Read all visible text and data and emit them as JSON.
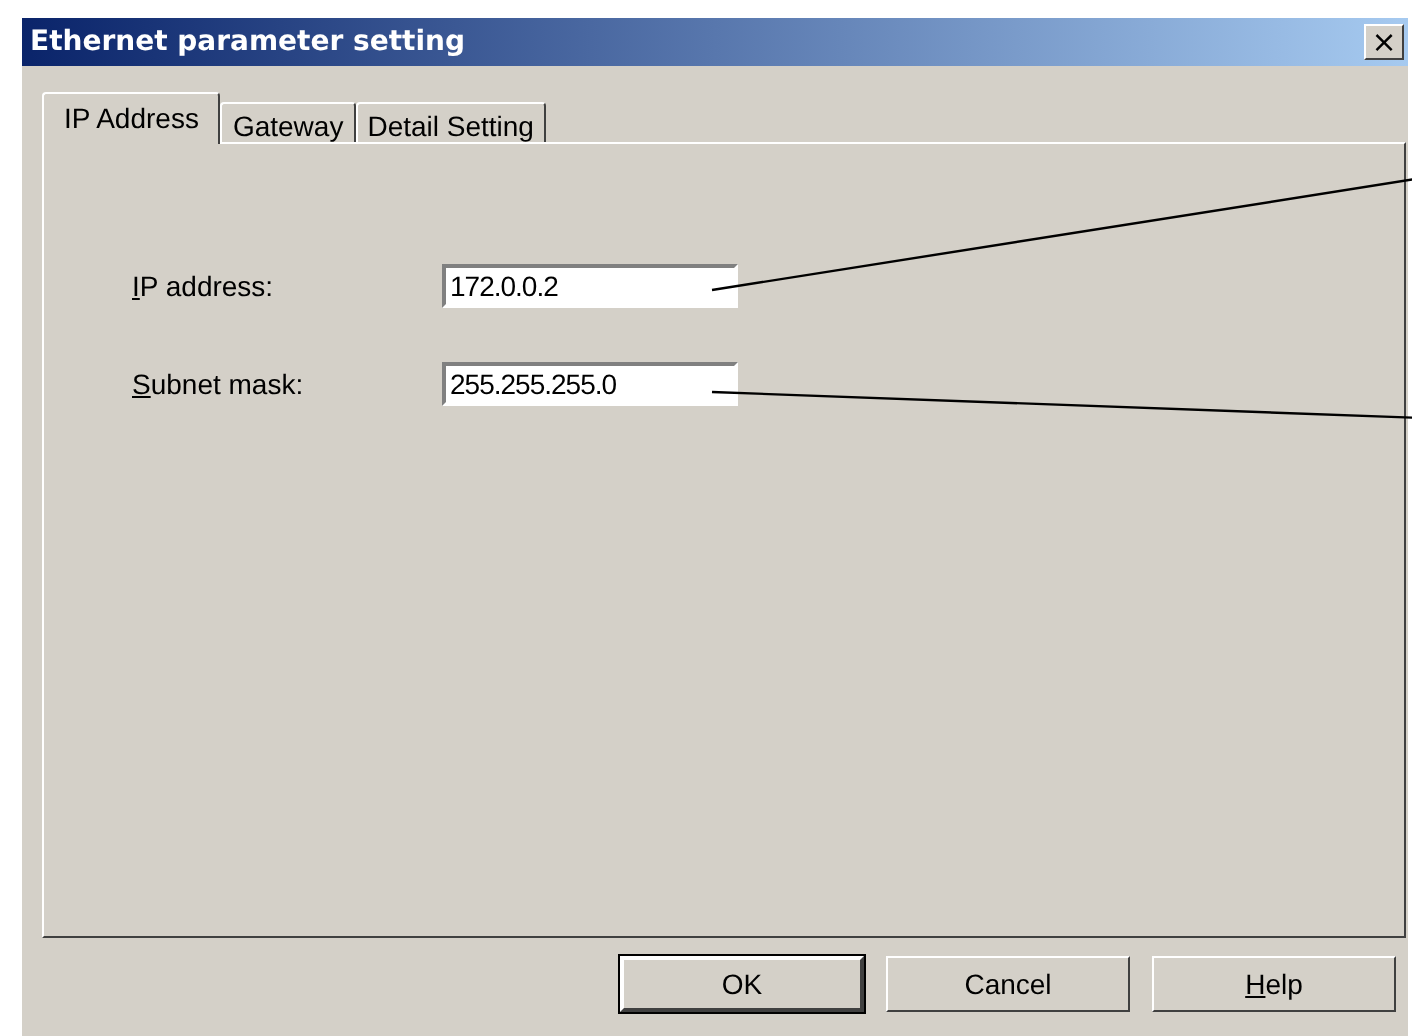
{
  "window": {
    "title": "Ethernet parameter setting",
    "close": "×"
  },
  "tabs": [
    {
      "label": "IP Address",
      "selected": true
    },
    {
      "label": "Gateway",
      "selected": false
    },
    {
      "label": "Detail Setting",
      "selected": false
    }
  ],
  "fields": [
    {
      "label": "IP address:",
      "mnemonic": true,
      "value": "172.0.0.2"
    },
    {
      "label": "Subnet mask:",
      "mnemonic": true,
      "value": "255.255.255.0"
    }
  ],
  "buttons": [
    {
      "label": "OK",
      "default": true,
      "mnemonic": false
    },
    {
      "label": "Cancel",
      "default": false,
      "mnemonic": false
    },
    {
      "label": "Help",
      "default": false,
      "mnemonic": true
    }
  ]
}
